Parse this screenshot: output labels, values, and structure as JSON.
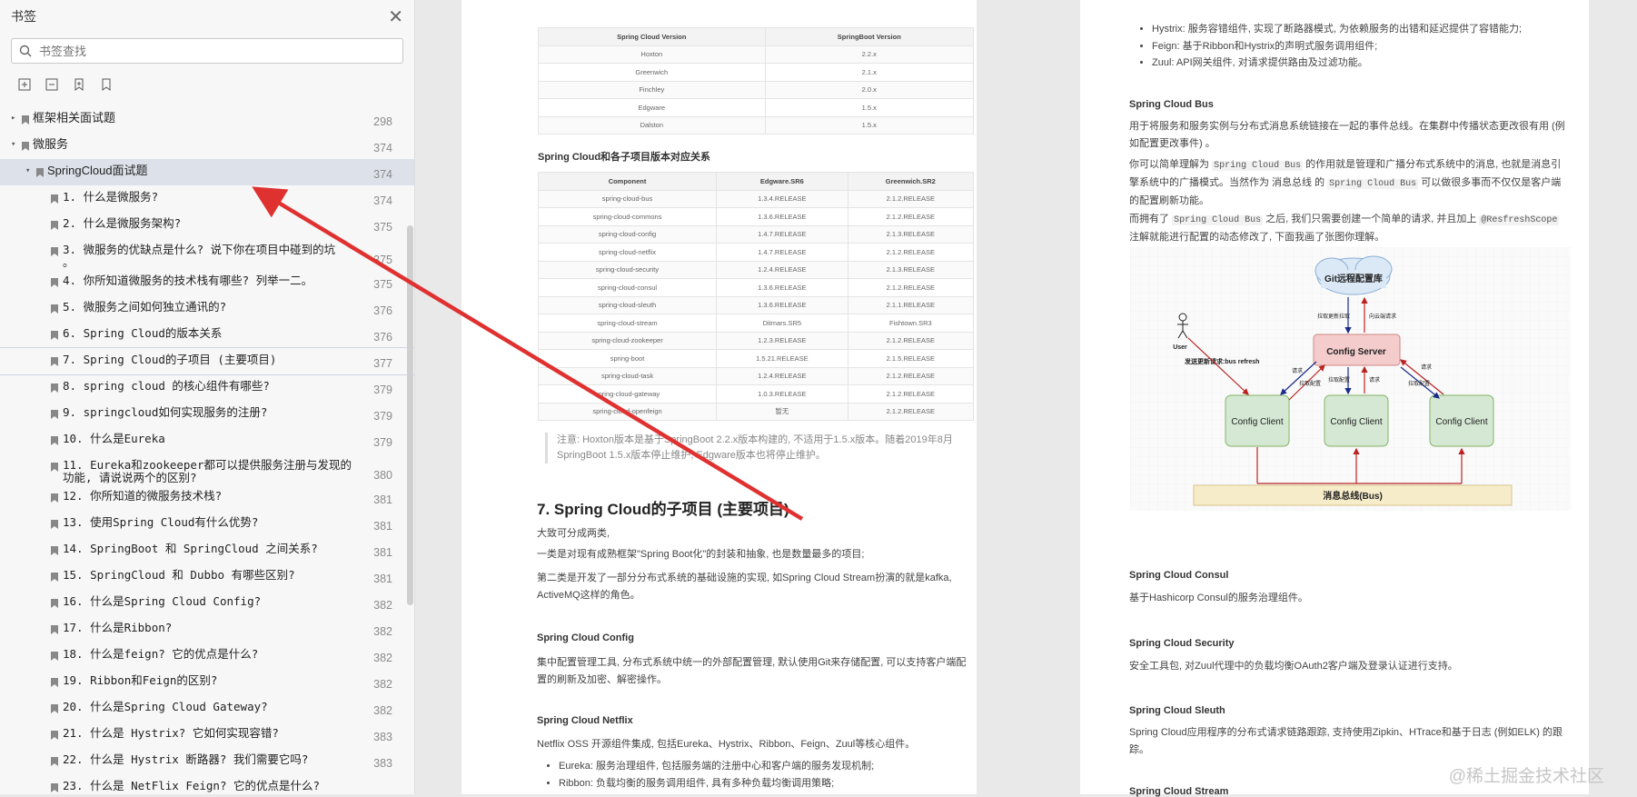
{
  "sidebar": {
    "title": "书签",
    "search_placeholder": "书签查找",
    "items": [
      {
        "label": "框架相关面试题",
        "page": "298",
        "level": 0,
        "caret": "▸"
      },
      {
        "label": "微服务",
        "page": "374",
        "level": 0,
        "caret": "▾"
      },
      {
        "label": "SpringCloud面试题",
        "page": "374",
        "level": 1,
        "caret": "▾"
      },
      {
        "label": "1. 什么是微服务?",
        "page": "374",
        "level": 2
      },
      {
        "label": "2. 什么是微服务架构?",
        "page": "375",
        "level": 2
      },
      {
        "label": "3. 微服务的优缺点是什么? 说下你在项目中碰到的坑\n。",
        "page": "375",
        "level": 2
      },
      {
        "label": "4. 你所知道微服务的技术栈有哪些? 列举一二。",
        "page": "375",
        "level": 2
      },
      {
        "label": "5. 微服务之间如何独立通讯的?",
        "page": "376",
        "level": 2
      },
      {
        "label": "6. Spring Cloud的版本关系",
        "page": "376",
        "level": 2
      },
      {
        "label": "7. Spring Cloud的子项目 (主要项目)",
        "page": "377",
        "level": 2
      },
      {
        "label": "8. spring cloud 的核心组件有哪些?",
        "page": "379",
        "level": 2
      },
      {
        "label": "9. springcloud如何实现服务的注册?",
        "page": "379",
        "level": 2
      },
      {
        "label": "10. 什么是Eureka",
        "page": "379",
        "level": 2
      },
      {
        "label": "11. Eureka和zookeeper都可以提供服务注册与发现的\n功能, 请说说两个的区别?",
        "page": "380",
        "level": 2
      },
      {
        "label": "12. 你所知道的微服务技术栈?",
        "page": "381",
        "level": 2
      },
      {
        "label": "13. 使用Spring Cloud有什么优势?",
        "page": "381",
        "level": 2
      },
      {
        "label": "14. SpringBoot 和 SpringCloud 之间关系?",
        "page": "381",
        "level": 2
      },
      {
        "label": "15. SpringCloud 和 Dubbo 有哪些区别?",
        "page": "381",
        "level": 2
      },
      {
        "label": "16. 什么是Spring Cloud Config?",
        "page": "382",
        "level": 2
      },
      {
        "label": "17. 什么是Ribbon?",
        "page": "382",
        "level": 2
      },
      {
        "label": "18. 什么是feign? 它的优点是什么?",
        "page": "382",
        "level": 2
      },
      {
        "label": "19. Ribbon和Feign的区别?",
        "page": "382",
        "level": 2
      },
      {
        "label": "20. 什么是Spring Cloud Gateway?",
        "page": "382",
        "level": 2
      },
      {
        "label": "21. 什么是 Hystrix? 它如何实现容错?",
        "page": "383",
        "level": 2
      },
      {
        "label": "22. 什么是 Hystrix 断路器? 我们需要它吗?",
        "page": "383",
        "level": 2
      },
      {
        "label": "23. 什么是 NetFlix Feign? 它的优点是什么?",
        "page": "",
        "level": 2
      }
    ]
  },
  "doc": {
    "table1": {
      "headers": [
        "Spring Cloud Version",
        "SpringBoot Version"
      ],
      "rows": [
        [
          "Hoxton",
          "2.2.x"
        ],
        [
          "Greenwich",
          "2.1.x"
        ],
        [
          "Finchley",
          "2.0.x"
        ],
        [
          "Edgware",
          "1.5.x"
        ],
        [
          "Dalston",
          "1.5.x"
        ]
      ]
    },
    "table2_title": "Spring Cloud和各子项目版本对应关系",
    "table2": {
      "headers": [
        "Component",
        "Edgware.SR6",
        "Greenwich.SR2"
      ],
      "rows": [
        [
          "spring-cloud-bus",
          "1.3.4.RELEASE",
          "2.1.2.RELEASE"
        ],
        [
          "spring-cloud-commons",
          "1.3.6.RELEASE",
          "2.1.2.RELEASE"
        ],
        [
          "spring-cloud-config",
          "1.4.7.RELEASE",
          "2.1.3.RELEASE"
        ],
        [
          "spring-cloud-netflix",
          "1.4.7.RELEASE",
          "2.1.2.RELEASE"
        ],
        [
          "spring-cloud-security",
          "1.2.4.RELEASE",
          "2.1.3.RELEASE"
        ],
        [
          "spring-cloud-consul",
          "1.3.6.RELEASE",
          "2.1.2.RELEASE"
        ],
        [
          "spring-cloud-sleuth",
          "1.3.6.RELEASE",
          "2.1.1.RELEASE"
        ],
        [
          "spring-cloud-stream",
          "Ditmars.SR5",
          "Fishtown.SR3"
        ],
        [
          "spring-cloud-zookeeper",
          "1.2.3.RELEASE",
          "2.1.2.RELEASE"
        ],
        [
          "spring-boot",
          "1.5.21.RELEASE",
          "2.1.5.RELEASE"
        ],
        [
          "spring-cloud-task",
          "1.2.4.RELEASE",
          "2.1.2.RELEASE"
        ],
        [
          "spring-cloud-gateway",
          "1.0.3.RELEASE",
          "2.1.2.RELEASE"
        ],
        [
          "spring-cloud-openfeign",
          "暂无",
          "2.1.2.RELEASE"
        ]
      ]
    },
    "note": "注意: Hoxton版本是基于SpringBoot 2.2.x版本构建的, 不适用于1.5.x版本。随着2019年8月SpringBoot 1.5.x版本停止维护, Edgware版本也将停止维护。",
    "section_title": "7. Spring Cloud的子项目 (主要项目)",
    "intro1": "大致可分成两类,",
    "intro2": "一类是对现有成熟框架\"Spring Boot化\"的封装和抽象, 也是数量最多的项目;",
    "intro3": "第二类是开发了一部分分布式系统的基础设施的实现, 如Spring Cloud Stream扮演的就是kafka, ActiveMQ这样的角色。",
    "config_title": "Spring Cloud Config",
    "config_text": "集中配置管理工具, 分布式系统中统一的外部配置管理, 默认使用Git来存储配置, 可以支持客户端配置的刷新及加密、解密操作。",
    "netflix_title": "Spring Cloud Netflix",
    "netflix_text": "Netflix OSS 开源组件集成, 包括Eureka、Hystrix、Ribbon、Feign、Zuul等核心组件。",
    "netflix_bullets": [
      "Eureka: 服务治理组件, 包括服务端的注册中心和客户端的服务发现机制;",
      "Ribbon: 负载均衡的服务调用组件, 具有多种负载均衡调用策略;"
    ],
    "right_bullets": [
      "Hystrix: 服务容错组件, 实现了断路器模式, 为依赖服务的出错和延迟提供了容错能力;",
      "Feign: 基于Ribbon和Hystrix的声明式服务调用组件;",
      "Zuul: API网关组件, 对请求提供路由及过滤功能。"
    ],
    "bus_title": "Spring Cloud Bus",
    "bus_p1": "用于将服务和服务实例与分布式消息系统链接在一起的事件总线。在集群中传播状态更改很有用 (例如配置更改事件) 。",
    "bus_p2_a": "你可以简单理解为 ",
    "bus_code1": "Spring Cloud Bus",
    "bus_p2_b": " 的作用就是管理和广播分布式系统中的消息, 也就是消息引擎系统中的广播模式。当然作为 消息总线 的 ",
    "bus_code2": "Spring Cloud Bus",
    "bus_p2_c": " 可以做很多事而不仅仅是客户端的配置刷新功能。",
    "bus_p3_a": "而拥有了 ",
    "bus_code3": "Spring Cloud Bus",
    "bus_p3_b": " 之后, 我们只需要创建一个简单的请求, 并且加上 ",
    "bus_code4": "@ResfreshScope",
    "bus_p3_c": " 注解就能进行配置的动态修改了, 下面我画了张图你理解。",
    "diagram": {
      "git": "Git远程配置库",
      "server": "Config Server",
      "client": "Config Client",
      "bus": "消息总线(Bus)",
      "user": "User",
      "send": "发送更新请求:bus refresh",
      "pull": "拉取更新拉取",
      "req": "向云端请求",
      "r1": "请求",
      "r2": "拉取配置",
      "r3": "请求"
    },
    "consul_title": "Spring Cloud Consul",
    "consul_text": "基于Hashicorp Consul的服务治理组件。",
    "security_title": "Spring Cloud Security",
    "security_text": "安全工具包, 对Zuul代理中的负载均衡OAuth2客户端及登录认证进行支持。",
    "sleuth_title": "Spring Cloud Sleuth",
    "sleuth_text": "Spring Cloud应用程序的分布式请求链路跟踪, 支持使用Zipkin、HTrace和基于日志 (例如ELK) 的跟踪。",
    "stream_title": "Spring Cloud Stream"
  },
  "watermark": "@稀土掘金技术社区",
  "colors": {
    "arrow": "#e03131",
    "selected": "#dde2ea"
  }
}
